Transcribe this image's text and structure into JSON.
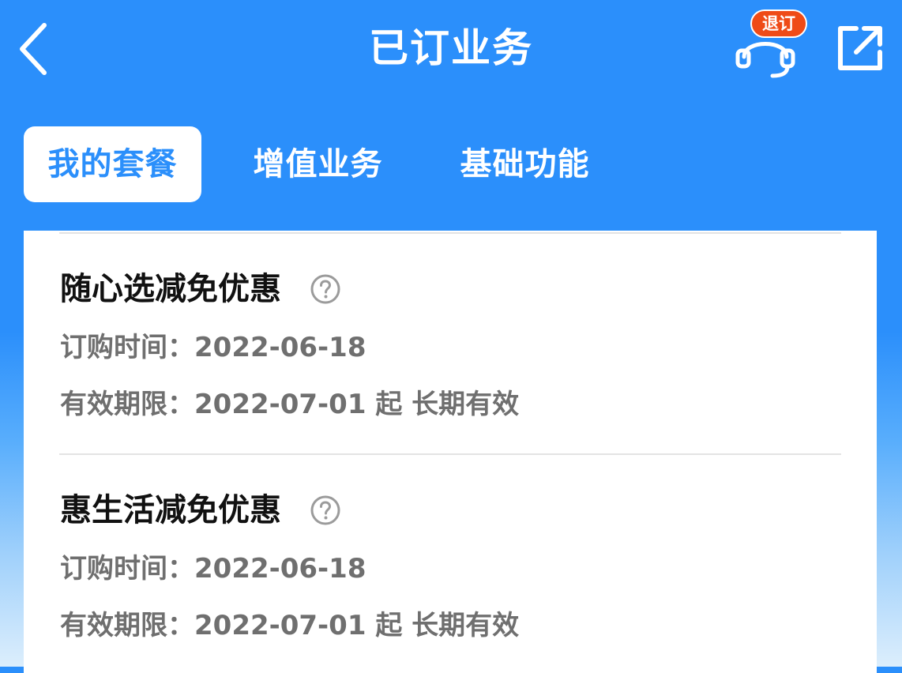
{
  "header": {
    "title": "已订业务",
    "back_icon": "chevron-left-icon",
    "service_icon": "headset-icon",
    "service_badge": "退订",
    "share_icon": "share-external-icon",
    "badge_color": "#ef4b17",
    "brand_color": "#2b8ffb"
  },
  "tabs": [
    {
      "label": "我的套餐",
      "active": true
    },
    {
      "label": "增值业务",
      "active": false
    },
    {
      "label": "基础功能",
      "active": false
    }
  ],
  "items": [
    {
      "title": "随心选减免优惠",
      "help_icon": "question-circle-icon",
      "order_label": "订购时间：",
      "order_date": "2022-06-18",
      "valid_label": "有效期限：",
      "valid_value": "2022-07-01 起 长期有效"
    },
    {
      "title": "惠生活减免优惠",
      "help_icon": "question-circle-icon",
      "order_label": "订购时间：",
      "order_date": "2022-06-18",
      "valid_label": "有效期限：",
      "valid_value": "2022-07-01 起 长期有效"
    }
  ]
}
